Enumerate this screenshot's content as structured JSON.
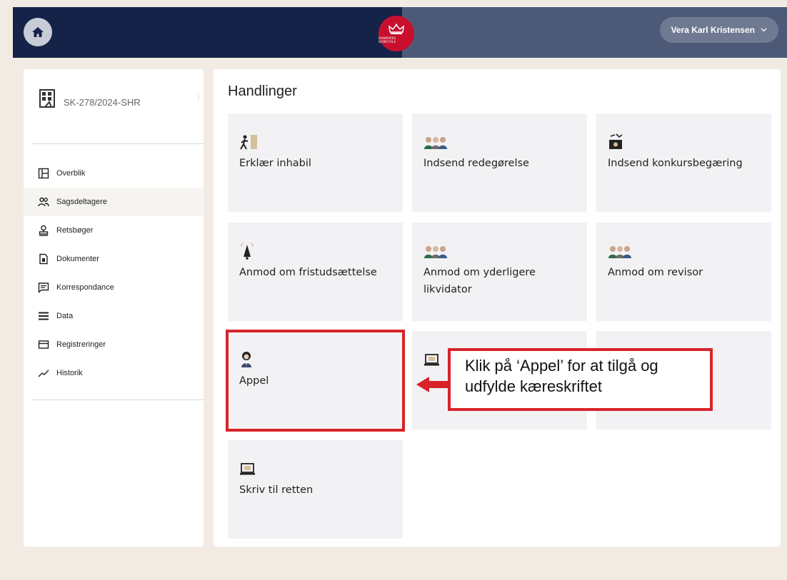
{
  "header": {
    "user_name": "Vera Karl Kristensen",
    "crest_text": "DANMARKS DOMSTOLE",
    "home_icon": "home-icon",
    "user_chevron_icon": "chevron-down-icon"
  },
  "sidebar": {
    "case_id": "SK-278/2024-SHR",
    "items": [
      {
        "label": "Overblik",
        "icon": "layout-icon"
      },
      {
        "label": "Sagsdeltagere",
        "icon": "users-icon"
      },
      {
        "label": "Retsbøger",
        "icon": "stamp-icon"
      },
      {
        "label": "Dokumenter",
        "icon": "document-icon"
      },
      {
        "label": "Korrespondance",
        "icon": "message-icon"
      },
      {
        "label": "Data",
        "icon": "list-icon"
      },
      {
        "label": "Registreringer",
        "icon": "card-icon"
      },
      {
        "label": "Historik",
        "icon": "trend-icon"
      }
    ]
  },
  "main": {
    "title": "Handlinger",
    "tiles": [
      {
        "label": "Erklær inhabil",
        "icon": "exit-person-icon"
      },
      {
        "label": "Indsend redegørelse",
        "icon": "people-icon"
      },
      {
        "label": "Indsend konkursbegæring",
        "icon": "broken-box-icon"
      },
      {
        "label": "Anmod om fristudsættelse",
        "icon": "bell-icon"
      },
      {
        "label": "Anmod om yderligere likvidator",
        "icon": "people-icon"
      },
      {
        "label": "Anmod om revisor",
        "icon": "people-icon"
      },
      {
        "label": "Appel",
        "icon": "judge-icon"
      },
      {
        "label": "",
        "icon": "laptop-icon"
      },
      {
        "label": "",
        "icon": ""
      },
      {
        "label": "Skriv til retten",
        "icon": "laptop-icon"
      }
    ]
  },
  "annotation": {
    "callout_text": "Klik på ‘Appel’ for at tilgå og udfylde kæreskriftet",
    "color": "#d8232a"
  },
  "colors": {
    "header_dark": "#152348",
    "header_slate": "#4c5a78",
    "background": "#f1ebe4",
    "tile": "#f2f2f4",
    "crest_red": "#c8102e"
  }
}
